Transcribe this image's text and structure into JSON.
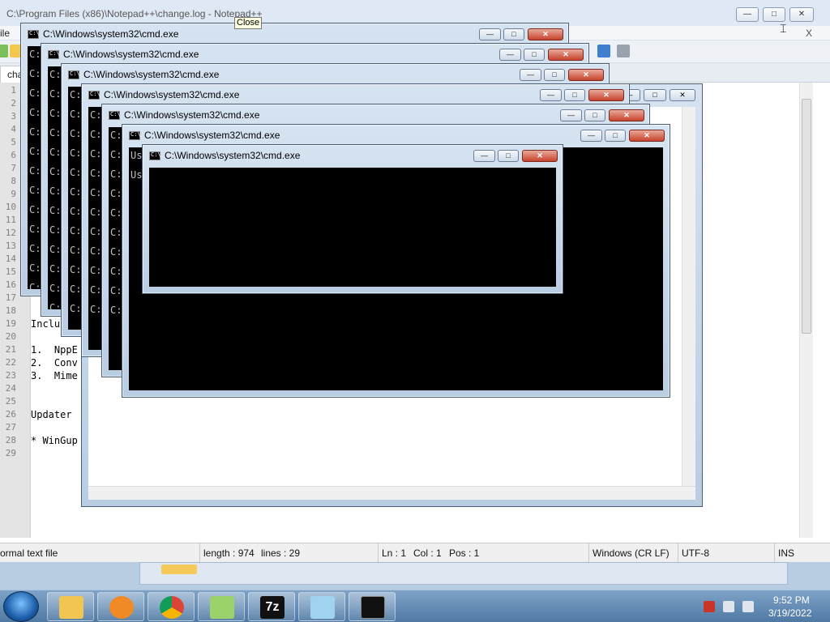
{
  "npp": {
    "title": "C:\\Program Files (x86)\\Notepad++\\change.log - Notepad++",
    "menu_first": "ile",
    "menu_close": "X",
    "tab_label": "chan",
    "tooltip": "Close",
    "line_numbers": [
      "1",
      "2",
      "3",
      "4",
      "5",
      "6",
      "7",
      "8",
      "9",
      "10",
      "11",
      "12",
      "13",
      "14",
      "15",
      "16",
      "17",
      "18",
      "19",
      "20",
      "21",
      "22",
      "23",
      "24",
      "25",
      "26",
      "27",
      "28",
      "29"
    ],
    "code_lines": [
      {
        "n": 19,
        "text": "Inclu"
      },
      {
        "n": 21,
        "text": "1.  NppE"
      },
      {
        "n": 22,
        "text": "2.  Conv"
      },
      {
        "n": 23,
        "text": "3.  Mime"
      },
      {
        "n": 26,
        "text": "Updater"
      },
      {
        "n": 28,
        "text": "* WinGup"
      }
    ],
    "status": {
      "type": "ormal text file",
      "length": "length : 974",
      "lines": "lines : 29",
      "ln": "Ln : 1",
      "col": "Col : 1",
      "pos": "Pos : 1",
      "eol": "Windows (CR LF)",
      "encoding": "UTF-8",
      "mode": "INS"
    }
  },
  "cmd_title": "C:\\Windows\\system32\\cmd.exe",
  "cmd_prompt_char": "C:",
  "cmd_prompt_alt": "Us",
  "window_buttons": {
    "min": "—",
    "max": "□",
    "close": "✕"
  },
  "taskbar": {
    "time": "9:52 PM",
    "date": "3/19/2022",
    "buttons": [
      "explorer",
      "media-player",
      "chrome",
      "notepad-plus-plus",
      "7zip",
      "notepad",
      "cmd"
    ]
  },
  "colors": {
    "accent": "#3b6ea5",
    "cmd_bg": "#000000",
    "close_btn": "#c7432d"
  }
}
